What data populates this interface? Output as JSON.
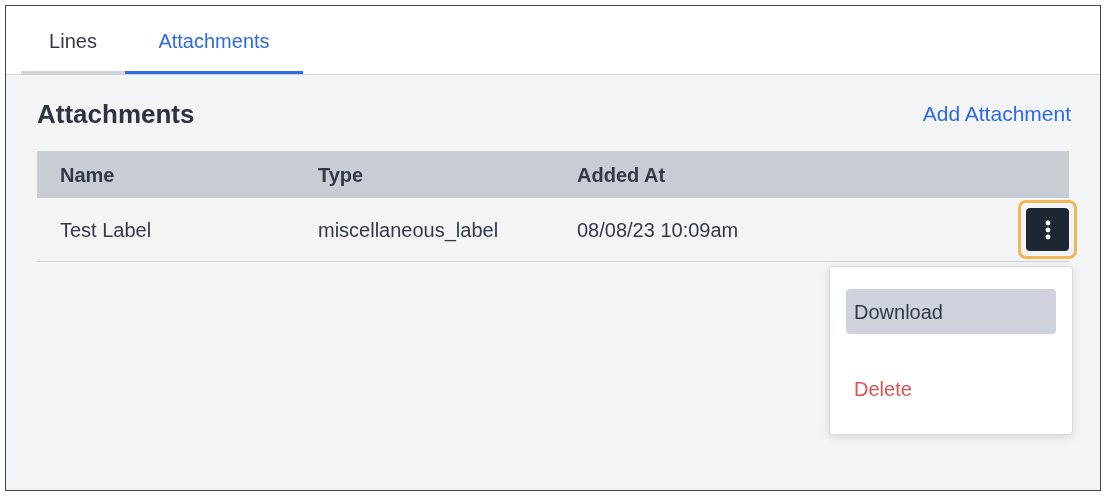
{
  "tabs": [
    {
      "label": "Lines",
      "selected": false
    },
    {
      "label": "Attachments",
      "selected": true
    }
  ],
  "section": {
    "title": "Attachments",
    "action": "Add Attachment"
  },
  "table": {
    "columns": [
      "Name",
      "Type",
      "Added At"
    ],
    "rows": [
      {
        "cells": [
          "Test Label",
          "miscellaneous_label",
          "08/08/23 10:09am"
        ],
        "menu_button_focused": true
      }
    ]
  },
  "menu": {
    "items": [
      {
        "label": "Download",
        "kind": "default",
        "highlighted": true
      },
      {
        "label": "Delete",
        "kind": "danger",
        "highlighted": false
      }
    ]
  }
}
